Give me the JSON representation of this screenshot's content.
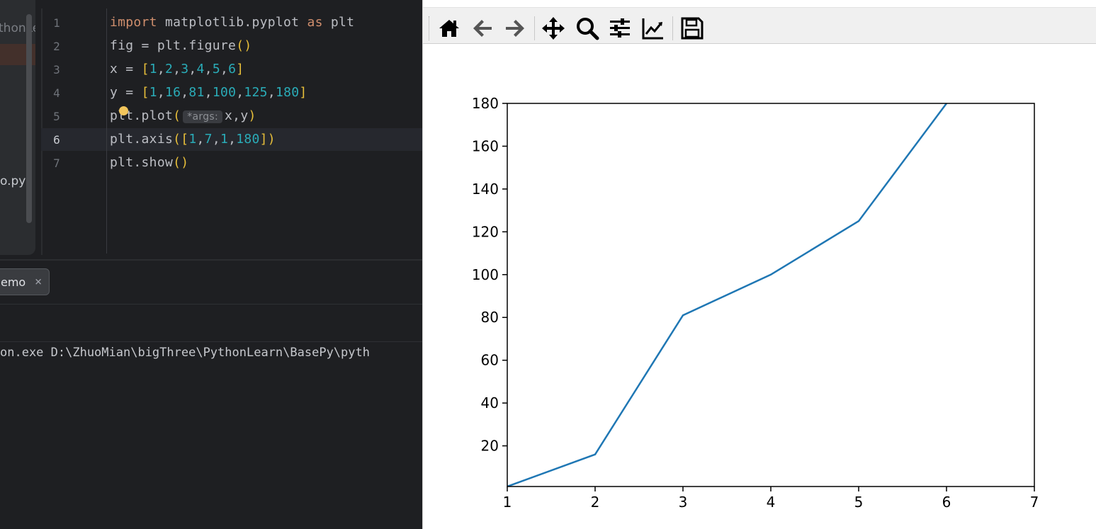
{
  "ide": {
    "project_items": [
      "thonLe",
      "o.py"
    ],
    "editor": {
      "line_numbers": [
        "1",
        "2",
        "3",
        "4",
        "5",
        "6",
        "7"
      ],
      "current_line": 6,
      "lines": [
        [
          {
            "t": "import",
            "c": "kw"
          },
          {
            "t": " matplotlib.pyplot ",
            "c": "fn"
          },
          {
            "t": "as",
            "c": "kw"
          },
          {
            "t": " plt",
            "c": "fn"
          }
        ],
        [
          {
            "t": "fig = plt.figure",
            "c": "fn"
          },
          {
            "t": "()",
            "c": "br"
          }
        ],
        [
          {
            "t": "x = ",
            "c": "fn"
          },
          {
            "t": "[",
            "c": "br"
          },
          {
            "t": "1",
            "c": "num"
          },
          {
            "t": ",",
            "c": "fn"
          },
          {
            "t": "2",
            "c": "num"
          },
          {
            "t": ",",
            "c": "fn"
          },
          {
            "t": "3",
            "c": "num"
          },
          {
            "t": ",",
            "c": "fn"
          },
          {
            "t": "4",
            "c": "num"
          },
          {
            "t": ",",
            "c": "fn"
          },
          {
            "t": "5",
            "c": "num"
          },
          {
            "t": ",",
            "c": "fn"
          },
          {
            "t": "6",
            "c": "num"
          },
          {
            "t": "]",
            "c": "br"
          }
        ],
        [
          {
            "t": "y = ",
            "c": "fn"
          },
          {
            "t": "[",
            "c": "br"
          },
          {
            "t": "1",
            "c": "num"
          },
          {
            "t": ",",
            "c": "fn"
          },
          {
            "t": "16",
            "c": "num"
          },
          {
            "t": ",",
            "c": "fn"
          },
          {
            "t": "81",
            "c": "num"
          },
          {
            "t": ",",
            "c": "fn"
          },
          {
            "t": "100",
            "c": "num"
          },
          {
            "t": ",",
            "c": "fn"
          },
          {
            "t": "125",
            "c": "num"
          },
          {
            "t": ",",
            "c": "fn"
          },
          {
            "t": "180",
            "c": "num"
          },
          {
            "t": "]",
            "c": "br"
          }
        ],
        [
          {
            "t": "plt.plot",
            "c": "fn"
          },
          {
            "t": "(",
            "c": "br"
          },
          {
            "t": "*args:",
            "c": "hint"
          },
          {
            "t": "x,y",
            "c": "fn"
          },
          {
            "t": ")",
            "c": "br"
          }
        ],
        [
          {
            "t": "plt.axis",
            "c": "fn"
          },
          {
            "t": "(",
            "c": "br"
          },
          {
            "t": "[",
            "c": "br"
          },
          {
            "t": "1",
            "c": "num"
          },
          {
            "t": ",",
            "c": "fn"
          },
          {
            "t": "7",
            "c": "num"
          },
          {
            "t": ",",
            "c": "fn"
          },
          {
            "t": "1",
            "c": "num"
          },
          {
            "t": ",",
            "c": "fn"
          },
          {
            "t": "180",
            "c": "num"
          },
          {
            "t": "]",
            "c": "br"
          },
          {
            "t": ")",
            "c": "br"
          }
        ],
        [
          {
            "t": "plt.show",
            "c": "fn"
          },
          {
            "t": "()",
            "c": "br"
          }
        ]
      ]
    },
    "run_tab_label": "emo",
    "run_tab_close": "×",
    "console_command": "on.exe D:\\ZhuoMian\\bigThree\\PythonLearn\\BasePy\\pyth"
  },
  "plot_window": {
    "toolbar": [
      {
        "name": "home-icon"
      },
      {
        "name": "back-icon"
      },
      {
        "name": "forward-icon"
      },
      {
        "name": "pan-icon"
      },
      {
        "name": "zoom-icon"
      },
      {
        "name": "configure-subplots-icon"
      },
      {
        "name": "edit-axis-icon"
      },
      {
        "name": "save-icon"
      }
    ]
  },
  "chart_data": {
    "type": "line",
    "x": [
      1,
      2,
      3,
      4,
      5,
      6
    ],
    "series": [
      {
        "values": [
          1,
          16,
          81,
          100,
          125,
          180
        ],
        "color": "#1f77b4"
      }
    ],
    "xlim": [
      1,
      7
    ],
    "ylim": [
      1,
      180
    ],
    "xticks": [
      "1",
      "2",
      "3",
      "4",
      "5",
      "6",
      "7"
    ],
    "yticks": [
      "20",
      "40",
      "60",
      "80",
      "100",
      "120",
      "140",
      "160",
      "180"
    ],
    "grid": false,
    "title": "",
    "xlabel": "",
    "ylabel": ""
  }
}
